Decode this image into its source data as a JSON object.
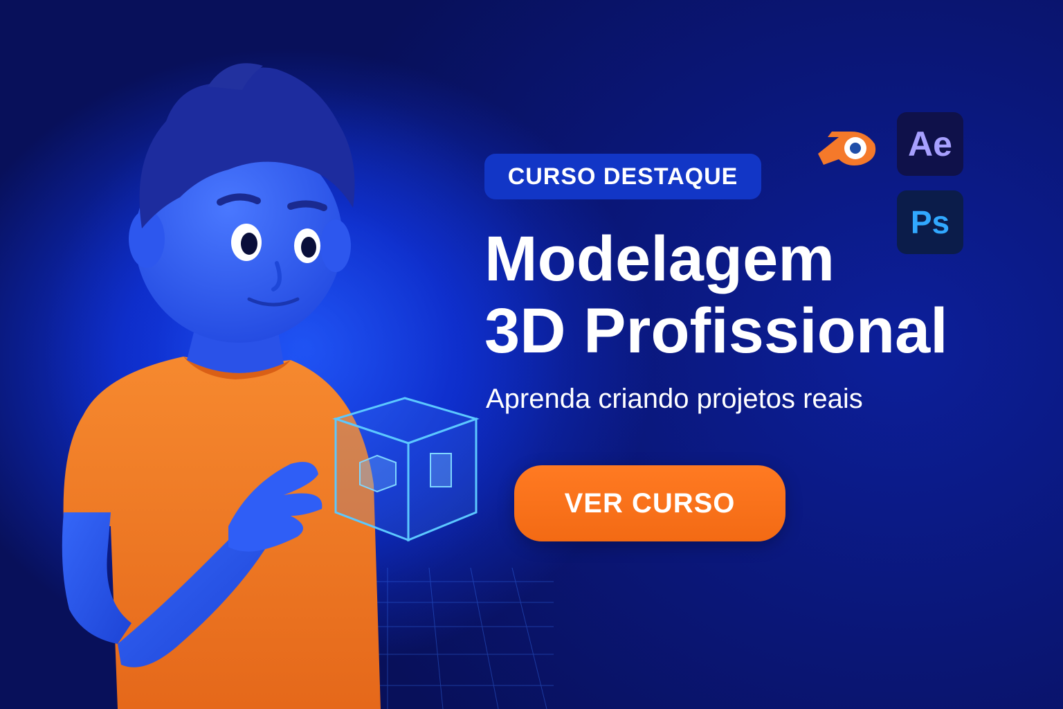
{
  "badge": {
    "label": "CURSO DESTAQUE"
  },
  "title": {
    "line1": "Modelagem",
    "line2": "3D Profissional"
  },
  "subtitle": "Aprenda criando projetos reais",
  "cta": {
    "label": "VER CURSO"
  },
  "apps": {
    "blender": {
      "icon": "blender-logo-icon"
    },
    "after_effects": {
      "label": "Ae",
      "icon": "after-effects-icon"
    },
    "photoshop": {
      "label": "Ps",
      "icon": "photoshop-icon"
    }
  },
  "colors": {
    "background": "#0a1a8c",
    "badge": "#1236c6",
    "accent_orange": "#f36a14",
    "character_skin": "#2d5cf5",
    "character_hair": "#1b2a9a",
    "shirt": "#f27a22"
  }
}
